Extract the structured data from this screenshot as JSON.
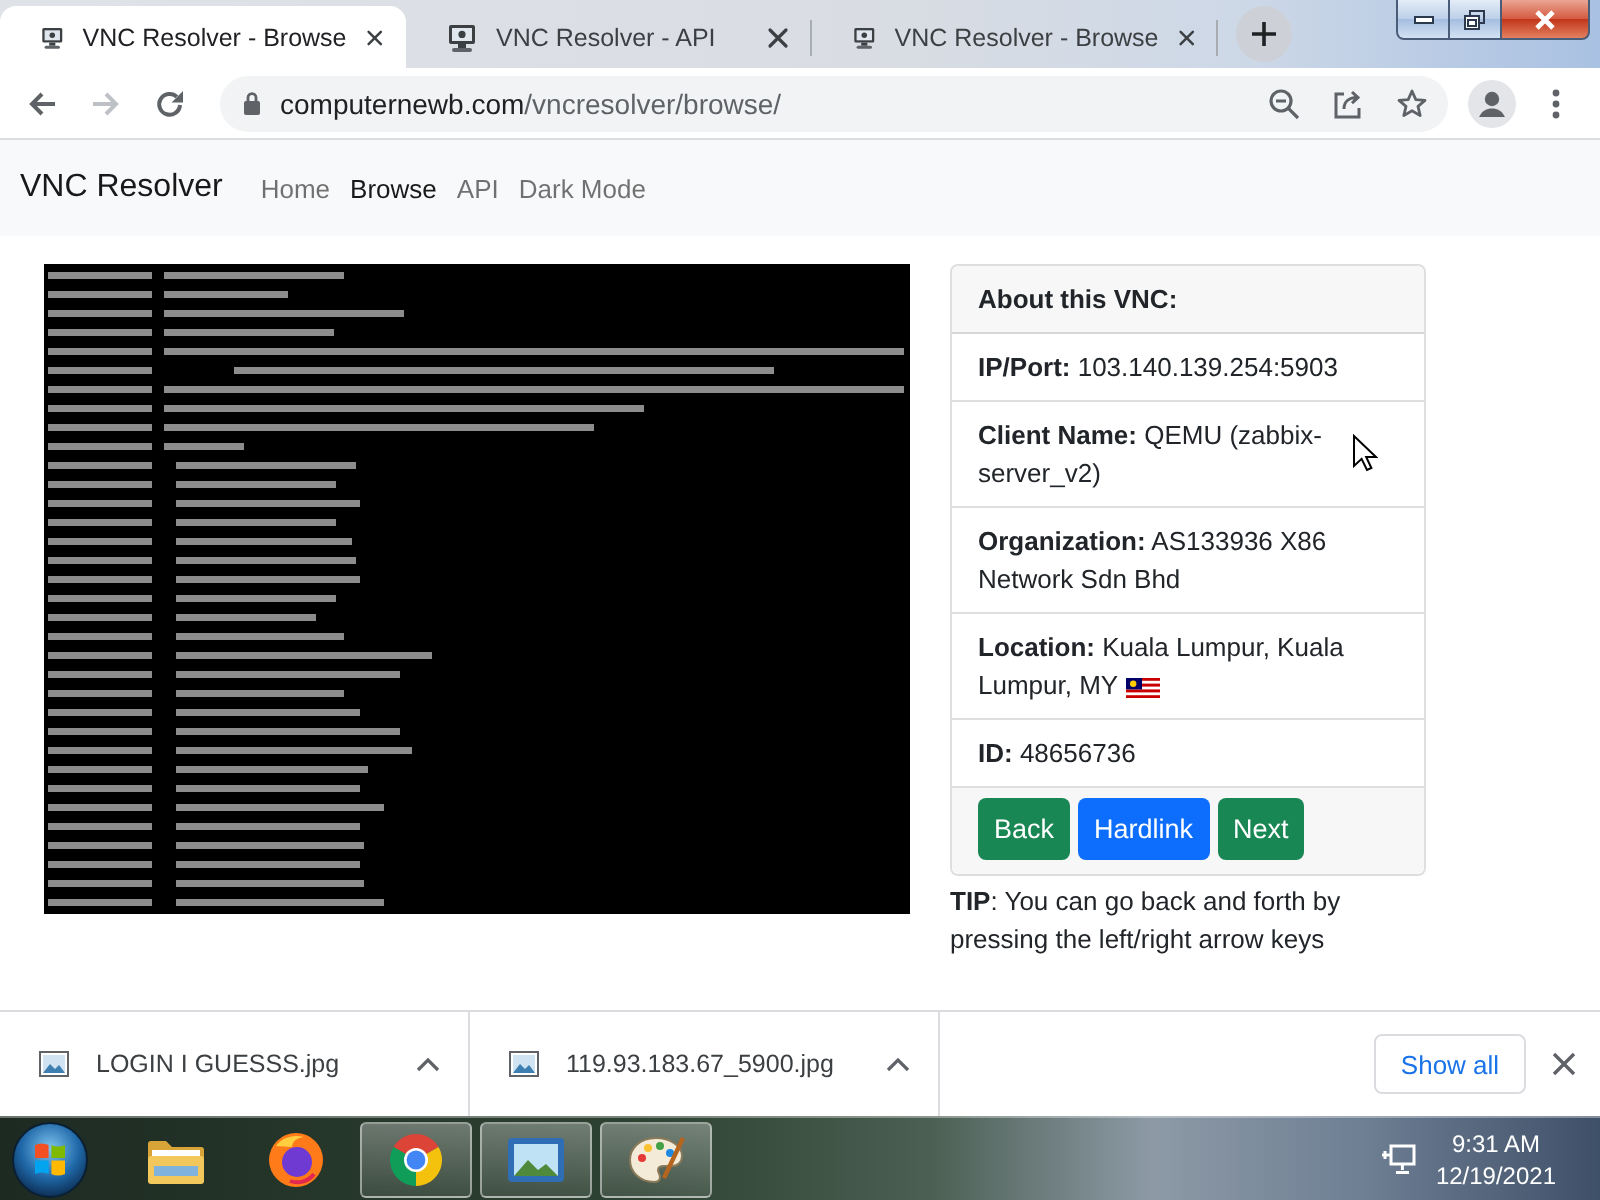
{
  "browser": {
    "tabs": [
      {
        "title": "VNC Resolver - Browse",
        "selected": true
      },
      {
        "title": "VNC Resolver - API",
        "selected": false
      },
      {
        "title": "VNC Resolver - Browse",
        "selected": false
      }
    ],
    "toolbar": {
      "nav_buttons": [
        {
          "kind": "back",
          "disabled": false
        },
        {
          "kind": "forward",
          "disabled": true
        },
        {
          "kind": "reload",
          "disabled": false
        }
      ],
      "address": {
        "host": "computernewb.com",
        "path": "/vncresolver/browse/"
      }
    }
  },
  "navbar": {
    "brand": "VNC Resolver",
    "links": [
      {
        "label": "Home",
        "selected": false
      },
      {
        "label": "Browse",
        "selected": true
      },
      {
        "label": "API",
        "selected": false
      },
      {
        "label": "Dark Mode",
        "selected": false
      }
    ]
  },
  "info_card": {
    "title": "About this VNC:",
    "fields": [
      {
        "label": "IP/Port:",
        "value": "103.140.139.254:5903",
        "flag": false
      },
      {
        "label": "Client Name:",
        "value": "QEMU (zabbix-server_v2)",
        "flag": false
      },
      {
        "label": "Organization:",
        "value": "AS133936 X86 Network Sdn Bhd",
        "flag": false
      },
      {
        "label": "Location:",
        "value": "Kuala Lumpur, Kuala Lumpur, MY",
        "flag": true
      },
      {
        "label": "ID:",
        "value": "48656736",
        "flag": false
      }
    ],
    "buttons": [
      {
        "label": "Back",
        "kind": "success"
      },
      {
        "label": "Hardlink",
        "kind": "primary"
      },
      {
        "label": "Next",
        "kind": "success"
      }
    ]
  },
  "tip": "**TIP**: You can go back and forth by pressing the left/right arrow keys",
  "downloads": {
    "items": [
      {
        "filename": "LOGIN I GUESSS.jpg"
      },
      {
        "filename": "119.93.183.67_5900.jpg"
      }
    ],
    "show_all": "Show all"
  },
  "taskbar": {
    "apps": [
      {
        "kind": "explorer",
        "running": false
      },
      {
        "kind": "firefox",
        "running": false
      },
      {
        "kind": "chrome",
        "running": true
      },
      {
        "kind": "photo_viewer",
        "running": true
      },
      {
        "kind": "paint",
        "running": true
      }
    ],
    "clock": {
      "time": "9:31 AM",
      "date": "12/19/2021"
    }
  }
}
